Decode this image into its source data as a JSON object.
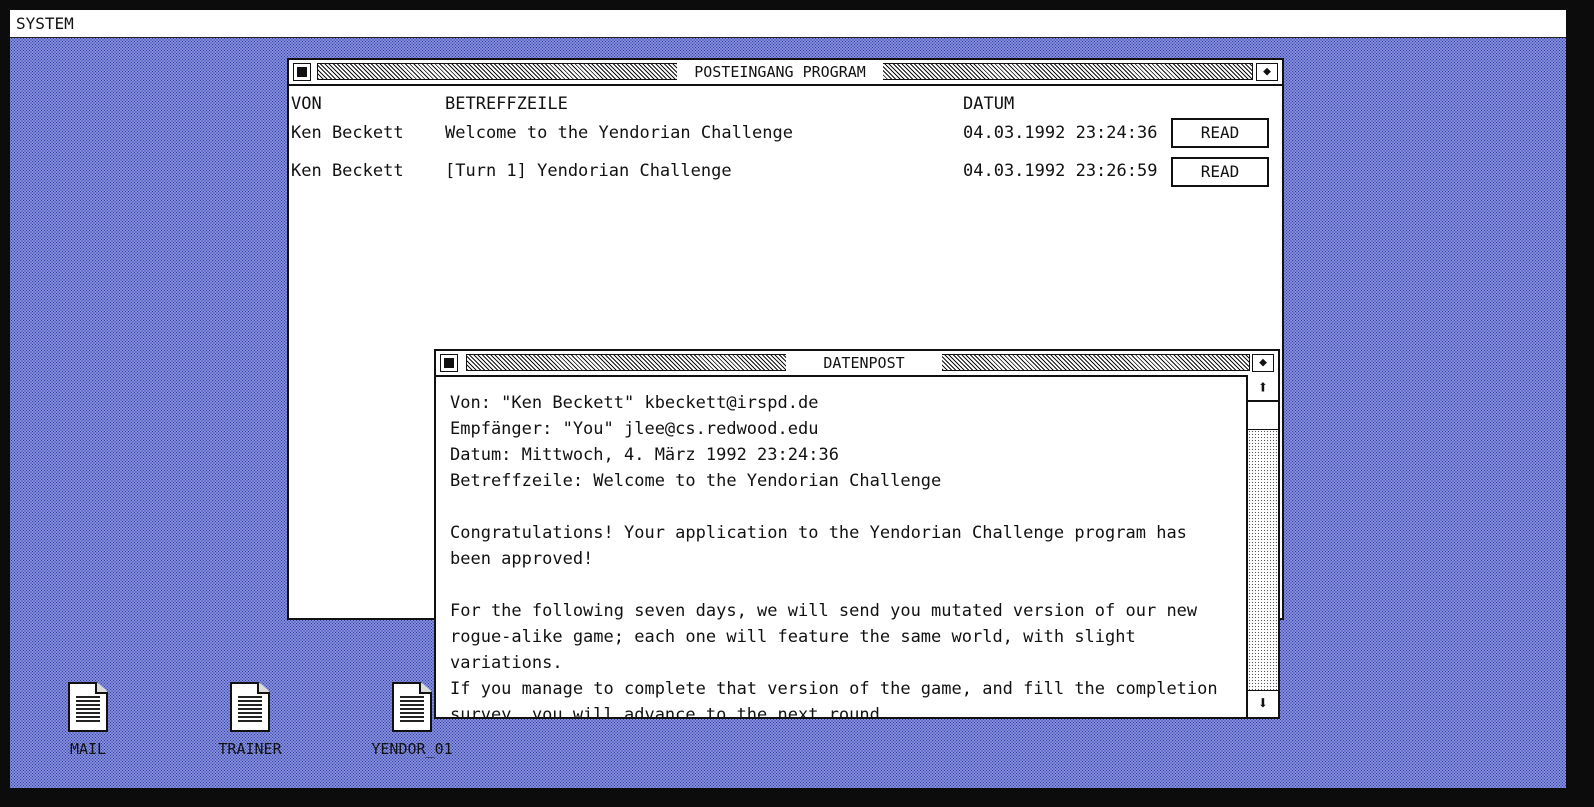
{
  "menubar": {
    "system_label": "SYSTEM"
  },
  "inbox": {
    "title": "POSTEINGANG PROGRAM",
    "columns": {
      "from": "VON",
      "subject": "BETREFFZEILE",
      "date": "DATUM"
    },
    "rows": [
      {
        "from": "Ken Beckett",
        "subject": "Welcome to the Yendorian Challenge",
        "date": "04.03.1992 23:24:36",
        "action": "READ"
      },
      {
        "from": "Ken Beckett",
        "subject": "[Turn 1] Yendorian Challenge",
        "date": "04.03.1992 23:26:59",
        "action": "READ"
      }
    ]
  },
  "reader": {
    "title": "DATENPOST",
    "lines": [
      "Von: \"Ken Beckett\" kbeckett@irspd.de",
      "Empfänger: \"You\" jlee@cs.redwood.edu",
      "Datum: Mittwoch, 4. März 1992 23:24:36",
      "Betreffzeile: Welcome to the Yendorian Challenge",
      "",
      "Congratulations! Your application to the Yendorian Challenge program has",
      "been approved!",
      "",
      "For the following seven days, we will send you mutated version of our new",
      "rogue-alike game; each one will feature the same world, with slight",
      "variations.",
      "If you manage to complete that version of the game, and fill the completion",
      "survey, you will advance to the next round."
    ],
    "scroll_up_icon": "arrow-up-icon",
    "scroll_down_icon": "arrow-down-icon"
  },
  "desktop": {
    "icons": [
      {
        "label": "MAIL",
        "icon": "document-icon"
      },
      {
        "label": "TRAINER",
        "icon": "document-icon"
      },
      {
        "label": "YENDOR_01",
        "icon": "document-icon"
      }
    ]
  },
  "colors": {
    "desktop": "#a7b1ef",
    "pattern": "#303aa6",
    "window": "#ffffff",
    "ink": "#111111"
  }
}
